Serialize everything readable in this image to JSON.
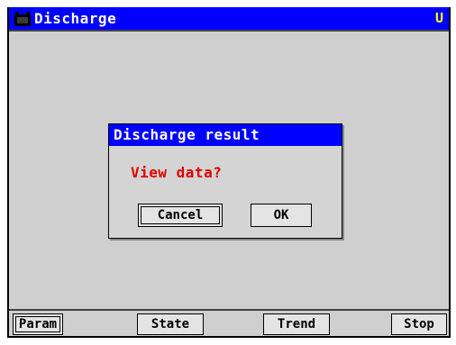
{
  "window": {
    "title": "Discharge",
    "title_icon": "battery-icon",
    "indicator": "U"
  },
  "dialog": {
    "title": "Discharge result",
    "message": "View data?",
    "cancel_label": "Cancel",
    "ok_label": "OK"
  },
  "bottom_bar": {
    "buttons": [
      {
        "label": "Param",
        "selected": true
      },
      {
        "label": "State",
        "selected": false
      },
      {
        "label": "Trend",
        "selected": false
      },
      {
        "label": "Stop",
        "selected": false
      }
    ]
  },
  "colors": {
    "titlebar": "#0000ff",
    "background": "#cfcfcf",
    "message": "#e00000",
    "indicator": "#ffff00"
  }
}
